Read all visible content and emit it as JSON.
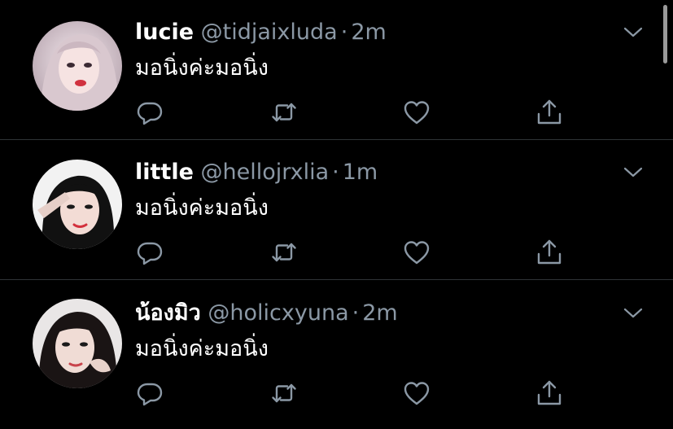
{
  "theme": {
    "background": "#000000",
    "text": "#ffffff",
    "muted": "#8b98a5",
    "divider": "#2f3336"
  },
  "icons": {
    "reply": "reply-icon",
    "retweet": "retweet-icon",
    "like": "like-icon",
    "share": "share-icon",
    "more": "chevron-down-icon"
  },
  "tweets": [
    {
      "display_name": "lucie",
      "handle": "@tidjaixluda",
      "separator": "·",
      "time": "2m",
      "text": "มอนิ่งค่ะมอนิ่ง"
    },
    {
      "display_name": "little",
      "handle": "@hellojrxlia",
      "separator": "·",
      "time": "1m",
      "text": "มอนิ่งค่ะมอนิ่ง"
    },
    {
      "display_name": "น้องมิว",
      "handle": "@holicxyuna",
      "separator": "·",
      "time": "2m",
      "text": "มอนิ่งค่ะมอนิ่ง"
    }
  ]
}
